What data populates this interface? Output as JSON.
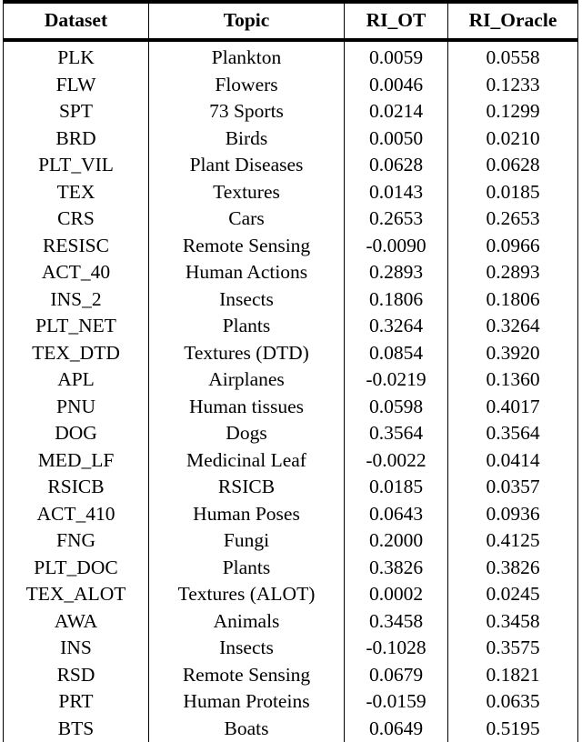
{
  "table": {
    "columns": [
      {
        "key": "dataset",
        "label": "Dataset"
      },
      {
        "key": "topic",
        "label": "Topic"
      },
      {
        "key": "ri_ot",
        "label": "RI_OT"
      },
      {
        "key": "ri_oracle",
        "label": "RI_Oracle"
      }
    ],
    "rows": [
      {
        "dataset": "PLK",
        "topic": "Plankton",
        "ri_ot": "0.0059",
        "ri_oracle": "0.0558"
      },
      {
        "dataset": "FLW",
        "topic": "Flowers",
        "ri_ot": "0.0046",
        "ri_oracle": "0.1233"
      },
      {
        "dataset": "SPT",
        "topic": "73 Sports",
        "ri_ot": "0.0214",
        "ri_oracle": "0.1299"
      },
      {
        "dataset": "BRD",
        "topic": "Birds",
        "ri_ot": "0.0050",
        "ri_oracle": "0.0210"
      },
      {
        "dataset": "PLT_VIL",
        "topic": "Plant Diseases",
        "ri_ot": "0.0628",
        "ri_oracle": "0.0628"
      },
      {
        "dataset": "TEX",
        "topic": "Textures",
        "ri_ot": "0.0143",
        "ri_oracle": "0.0185"
      },
      {
        "dataset": "CRS",
        "topic": "Cars",
        "ri_ot": "0.2653",
        "ri_oracle": "0.2653"
      },
      {
        "dataset": "RESISC",
        "topic": "Remote Sensing",
        "ri_ot": "-0.0090",
        "ri_oracle": "0.0966"
      },
      {
        "dataset": "ACT_40",
        "topic": "Human Actions",
        "ri_ot": "0.2893",
        "ri_oracle": "0.2893"
      },
      {
        "dataset": "INS_2",
        "topic": "Insects",
        "ri_ot": "0.1806",
        "ri_oracle": "0.1806"
      },
      {
        "dataset": "PLT_NET",
        "topic": "Plants",
        "ri_ot": "0.3264",
        "ri_oracle": "0.3264"
      },
      {
        "dataset": "TEX_DTD",
        "topic": "Textures (DTD)",
        "ri_ot": "0.0854",
        "ri_oracle": "0.3920"
      },
      {
        "dataset": "APL",
        "topic": "Airplanes",
        "ri_ot": "-0.0219",
        "ri_oracle": "0.1360"
      },
      {
        "dataset": "PNU",
        "topic": "Human tissues",
        "ri_ot": "0.0598",
        "ri_oracle": "0.4017"
      },
      {
        "dataset": "DOG",
        "topic": "Dogs",
        "ri_ot": "0.3564",
        "ri_oracle": "0.3564"
      },
      {
        "dataset": "MED_LF",
        "topic": "Medicinal Leaf",
        "ri_ot": "-0.0022",
        "ri_oracle": "0.0414"
      },
      {
        "dataset": "RSICB",
        "topic": "RSICB",
        "ri_ot": "0.0185",
        "ri_oracle": "0.0357"
      },
      {
        "dataset": "ACT_410",
        "topic": "Human Poses",
        "ri_ot": "0.0643",
        "ri_oracle": "0.0936"
      },
      {
        "dataset": "FNG",
        "topic": "Fungi",
        "ri_ot": "0.2000",
        "ri_oracle": "0.4125"
      },
      {
        "dataset": "PLT_DOC",
        "topic": "Plants",
        "ri_ot": "0.3826",
        "ri_oracle": "0.3826"
      },
      {
        "dataset": "TEX_ALOT",
        "topic": "Textures (ALOT)",
        "ri_ot": "0.0002",
        "ri_oracle": "0.0245"
      },
      {
        "dataset": "AWA",
        "topic": "Animals",
        "ri_ot": "0.3458",
        "ri_oracle": "0.3458"
      },
      {
        "dataset": "INS",
        "topic": "Insects",
        "ri_ot": "-0.1028",
        "ri_oracle": "0.3575"
      },
      {
        "dataset": "RSD",
        "topic": "Remote Sensing",
        "ri_ot": "0.0679",
        "ri_oracle": "0.1821"
      },
      {
        "dataset": "PRT",
        "topic": "Human Proteins",
        "ri_ot": "-0.0159",
        "ri_oracle": "0.0635"
      },
      {
        "dataset": "BTS",
        "topic": "Boats",
        "ri_ot": "0.0649",
        "ri_oracle": "0.5195"
      }
    ]
  }
}
